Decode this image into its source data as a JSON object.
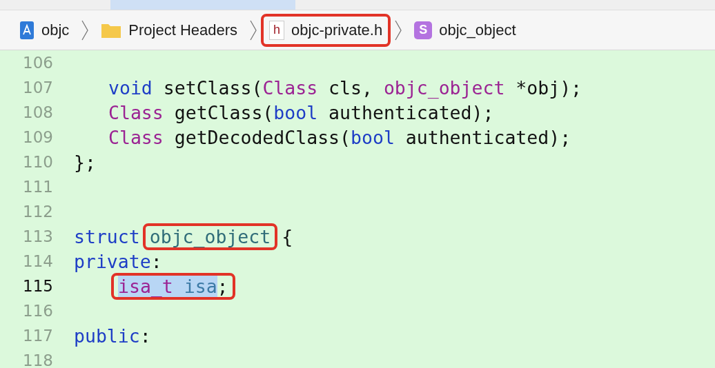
{
  "breadcrumb": [
    {
      "kind": "project",
      "label": "objc",
      "boxed": false
    },
    {
      "kind": "folder",
      "label": "Project Headers",
      "boxed": false
    },
    {
      "kind": "header",
      "glyph": "h",
      "label": "objc-private.h",
      "boxed": true
    },
    {
      "kind": "struct",
      "glyph": "S",
      "label": "objc_object",
      "boxed": false
    }
  ],
  "editor": {
    "lines": [
      {
        "number": "106",
        "current": false
      },
      {
        "number": "107",
        "current": false,
        "kind": "indented",
        "tokens": [
          {
            "kind": "keyword",
            "text": "void"
          },
          {
            "kind": "plain",
            "text": " setClass("
          },
          {
            "kind": "type",
            "text": "Class"
          },
          {
            "kind": "plain",
            "text": " cls, "
          },
          {
            "kind": "type",
            "text": "objc_object"
          },
          {
            "kind": "plain",
            "text": " *obj);"
          }
        ]
      },
      {
        "number": "108",
        "current": false,
        "kind": "indented",
        "tokens": [
          {
            "kind": "type",
            "text": "Class"
          },
          {
            "kind": "plain",
            "text": " getClass("
          },
          {
            "kind": "keyword",
            "text": "bool"
          },
          {
            "kind": "plain",
            "text": " authenticated);"
          }
        ]
      },
      {
        "number": "109",
        "current": false,
        "kind": "indented",
        "tokens": [
          {
            "kind": "type",
            "text": "Class"
          },
          {
            "kind": "plain",
            "text": " getDecodedClass("
          },
          {
            "kind": "keyword",
            "text": "bool"
          },
          {
            "kind": "plain",
            "text": " authenticated);"
          }
        ]
      },
      {
        "number": "110",
        "current": false,
        "kind": "flush",
        "tokens": [
          {
            "kind": "plain",
            "text": "};"
          }
        ]
      },
      {
        "number": "111",
        "current": false
      },
      {
        "number": "112",
        "current": false
      },
      {
        "number": "113",
        "current": false,
        "kind": "flush",
        "tokens": [
          {
            "kind": "keyword",
            "text": "struct"
          },
          {
            "kind": "box",
            "tokens": [
              {
                "kind": "declaration",
                "text": "objc_object"
              }
            ]
          },
          {
            "kind": "plain",
            "text": "{"
          }
        ]
      },
      {
        "number": "114",
        "current": false,
        "kind": "flush",
        "tokens": [
          {
            "kind": "keyword",
            "text": "private"
          },
          {
            "kind": "plain",
            "text": ":"
          }
        ]
      },
      {
        "number": "115",
        "current": true,
        "kind": "indented",
        "tokens": [
          {
            "kind": "box",
            "tokens": [
              {
                "kind": "selection",
                "tokens": [
                  {
                    "kind": "type",
                    "text": "isa_t"
                  },
                  {
                    "kind": "member",
                    "text": " isa"
                  }
                ]
              },
              {
                "kind": "plain",
                "text": ";"
              }
            ]
          }
        ]
      },
      {
        "number": "116",
        "current": false
      },
      {
        "number": "117",
        "current": false,
        "kind": "flush",
        "tokens": [
          {
            "kind": "keyword",
            "text": "public"
          },
          {
            "kind": "plain",
            "text": ":"
          }
        ]
      },
      {
        "number": "118",
        "current": false
      }
    ]
  }
}
